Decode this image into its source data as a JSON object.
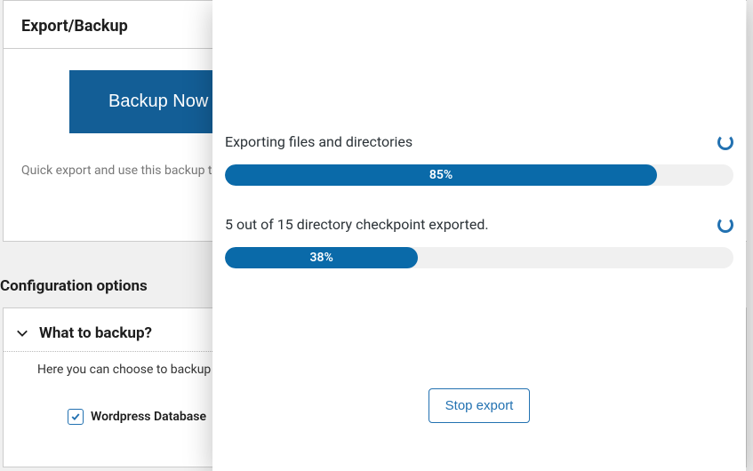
{
  "panels": {
    "export": {
      "title": "Export/Backup",
      "button": "Backup Now",
      "caption": "Quick export and use this backup t"
    }
  },
  "config": {
    "section_title": "Configuration options",
    "accordion_title": "What to backup?",
    "description": "Here you can choose to backup",
    "checkbox_label": "Wordpress Database",
    "checkbox_checked": true
  },
  "modal": {
    "progress": [
      {
        "label": "Exporting files and directories",
        "percent": 85,
        "percent_text": "85%"
      },
      {
        "label": "5 out of 15 directory checkpoint exported.",
        "percent": 38,
        "percent_text": "38%"
      }
    ],
    "stop_label": "Stop export"
  }
}
